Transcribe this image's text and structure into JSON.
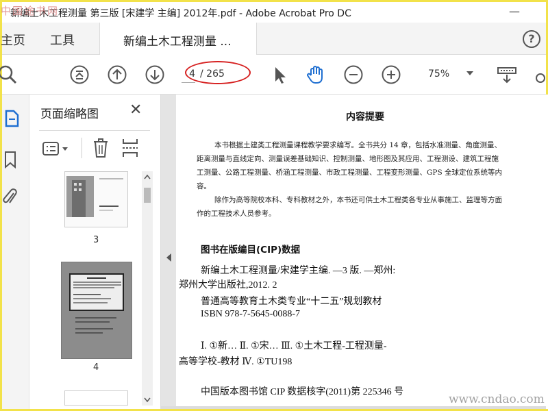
{
  "window": {
    "title": "新编土木工程测量 第三版 [宋建学 主编] 2012年.pdf - Adobe Acrobat Pro DC",
    "watermark_top": "中国途书网"
  },
  "tabs": {
    "home": "主页",
    "tools": "工具",
    "document": "新编土木工程测量 ..."
  },
  "help_label": "?",
  "toolbar": {
    "page_current": "4",
    "page_total": "/ 265",
    "zoom": "75%"
  },
  "thumbnails": {
    "title": "页面缩略图",
    "close": "✕",
    "items": [
      {
        "label": "3"
      },
      {
        "label": "4"
      }
    ]
  },
  "document": {
    "heading": "内容提要",
    "paragraphs": [
      "本书根据土建类工程测量课程教学要求编写。全书共分 14 章，包括水准测量、角度测量、",
      "距离测量与直线定向、测量误差基础知识、控制测量、地形图及其应用、工程测设、建筑工程施",
      "工测量、公路工程测量、桥涵工程测量、市政工程测量、工程变形测量、GPS 全球定位系统等内",
      "容。",
      "除作为高等院校本科、专科教材之外，本书还可供土木工程类各专业从事施工、监理等方面",
      "作的工程技术人员参考。"
    ],
    "cip_title": "图书在版编目(CIP)数据",
    "cip_lines": [
      "新编土木工程测量/宋建学主编. —3 版. —郑州:",
      "郑州大学出版社,2012. 2",
      "普通高等教育土木类专业“十二五”规划教材",
      "ISBN 978-7-5645-0088-7",
      "Ⅰ. ①新…   Ⅱ. ①宋…   Ⅲ. ①土木工程-工程测量-",
      "高等学校-教材   Ⅳ. ①TU198",
      "中国版本图书馆 CIP 数据核字(2011)第 225346 号"
    ]
  },
  "watermark_bottom": "www.cndao.com",
  "colors": {
    "annotation": "#d62020",
    "frame": "#f2e24a",
    "icon": "#555555"
  }
}
